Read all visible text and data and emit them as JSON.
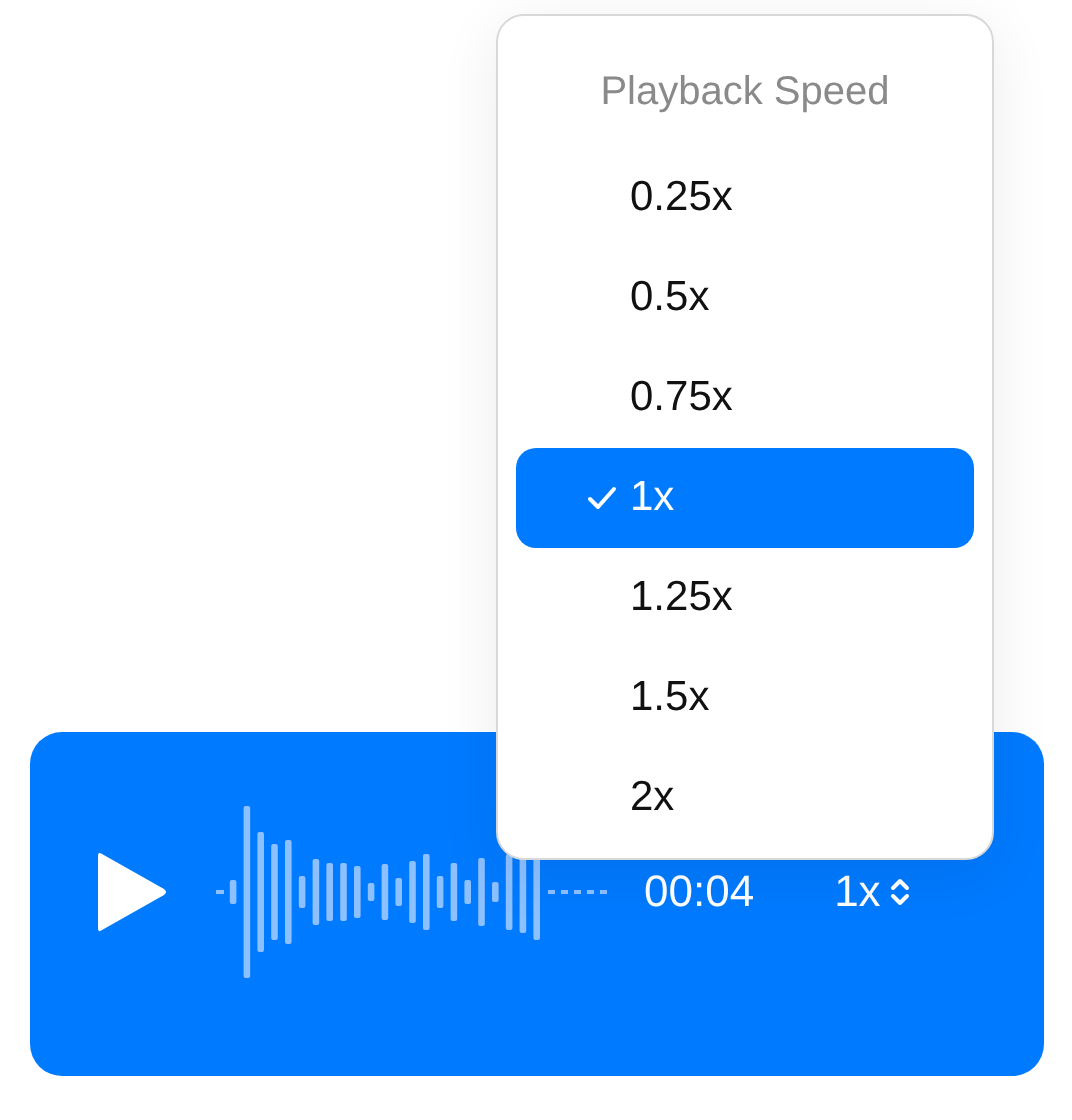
{
  "player": {
    "time": "00:04",
    "speed": "1x"
  },
  "speed_menu": {
    "title": "Playback Speed",
    "options": [
      {
        "label": "0.25x",
        "selected": false
      },
      {
        "label": "0.5x",
        "selected": false
      },
      {
        "label": "0.75x",
        "selected": false
      },
      {
        "label": "1x",
        "selected": true
      },
      {
        "label": "1.25x",
        "selected": false
      },
      {
        "label": "1.5x",
        "selected": false
      },
      {
        "label": "2x",
        "selected": false
      }
    ]
  }
}
